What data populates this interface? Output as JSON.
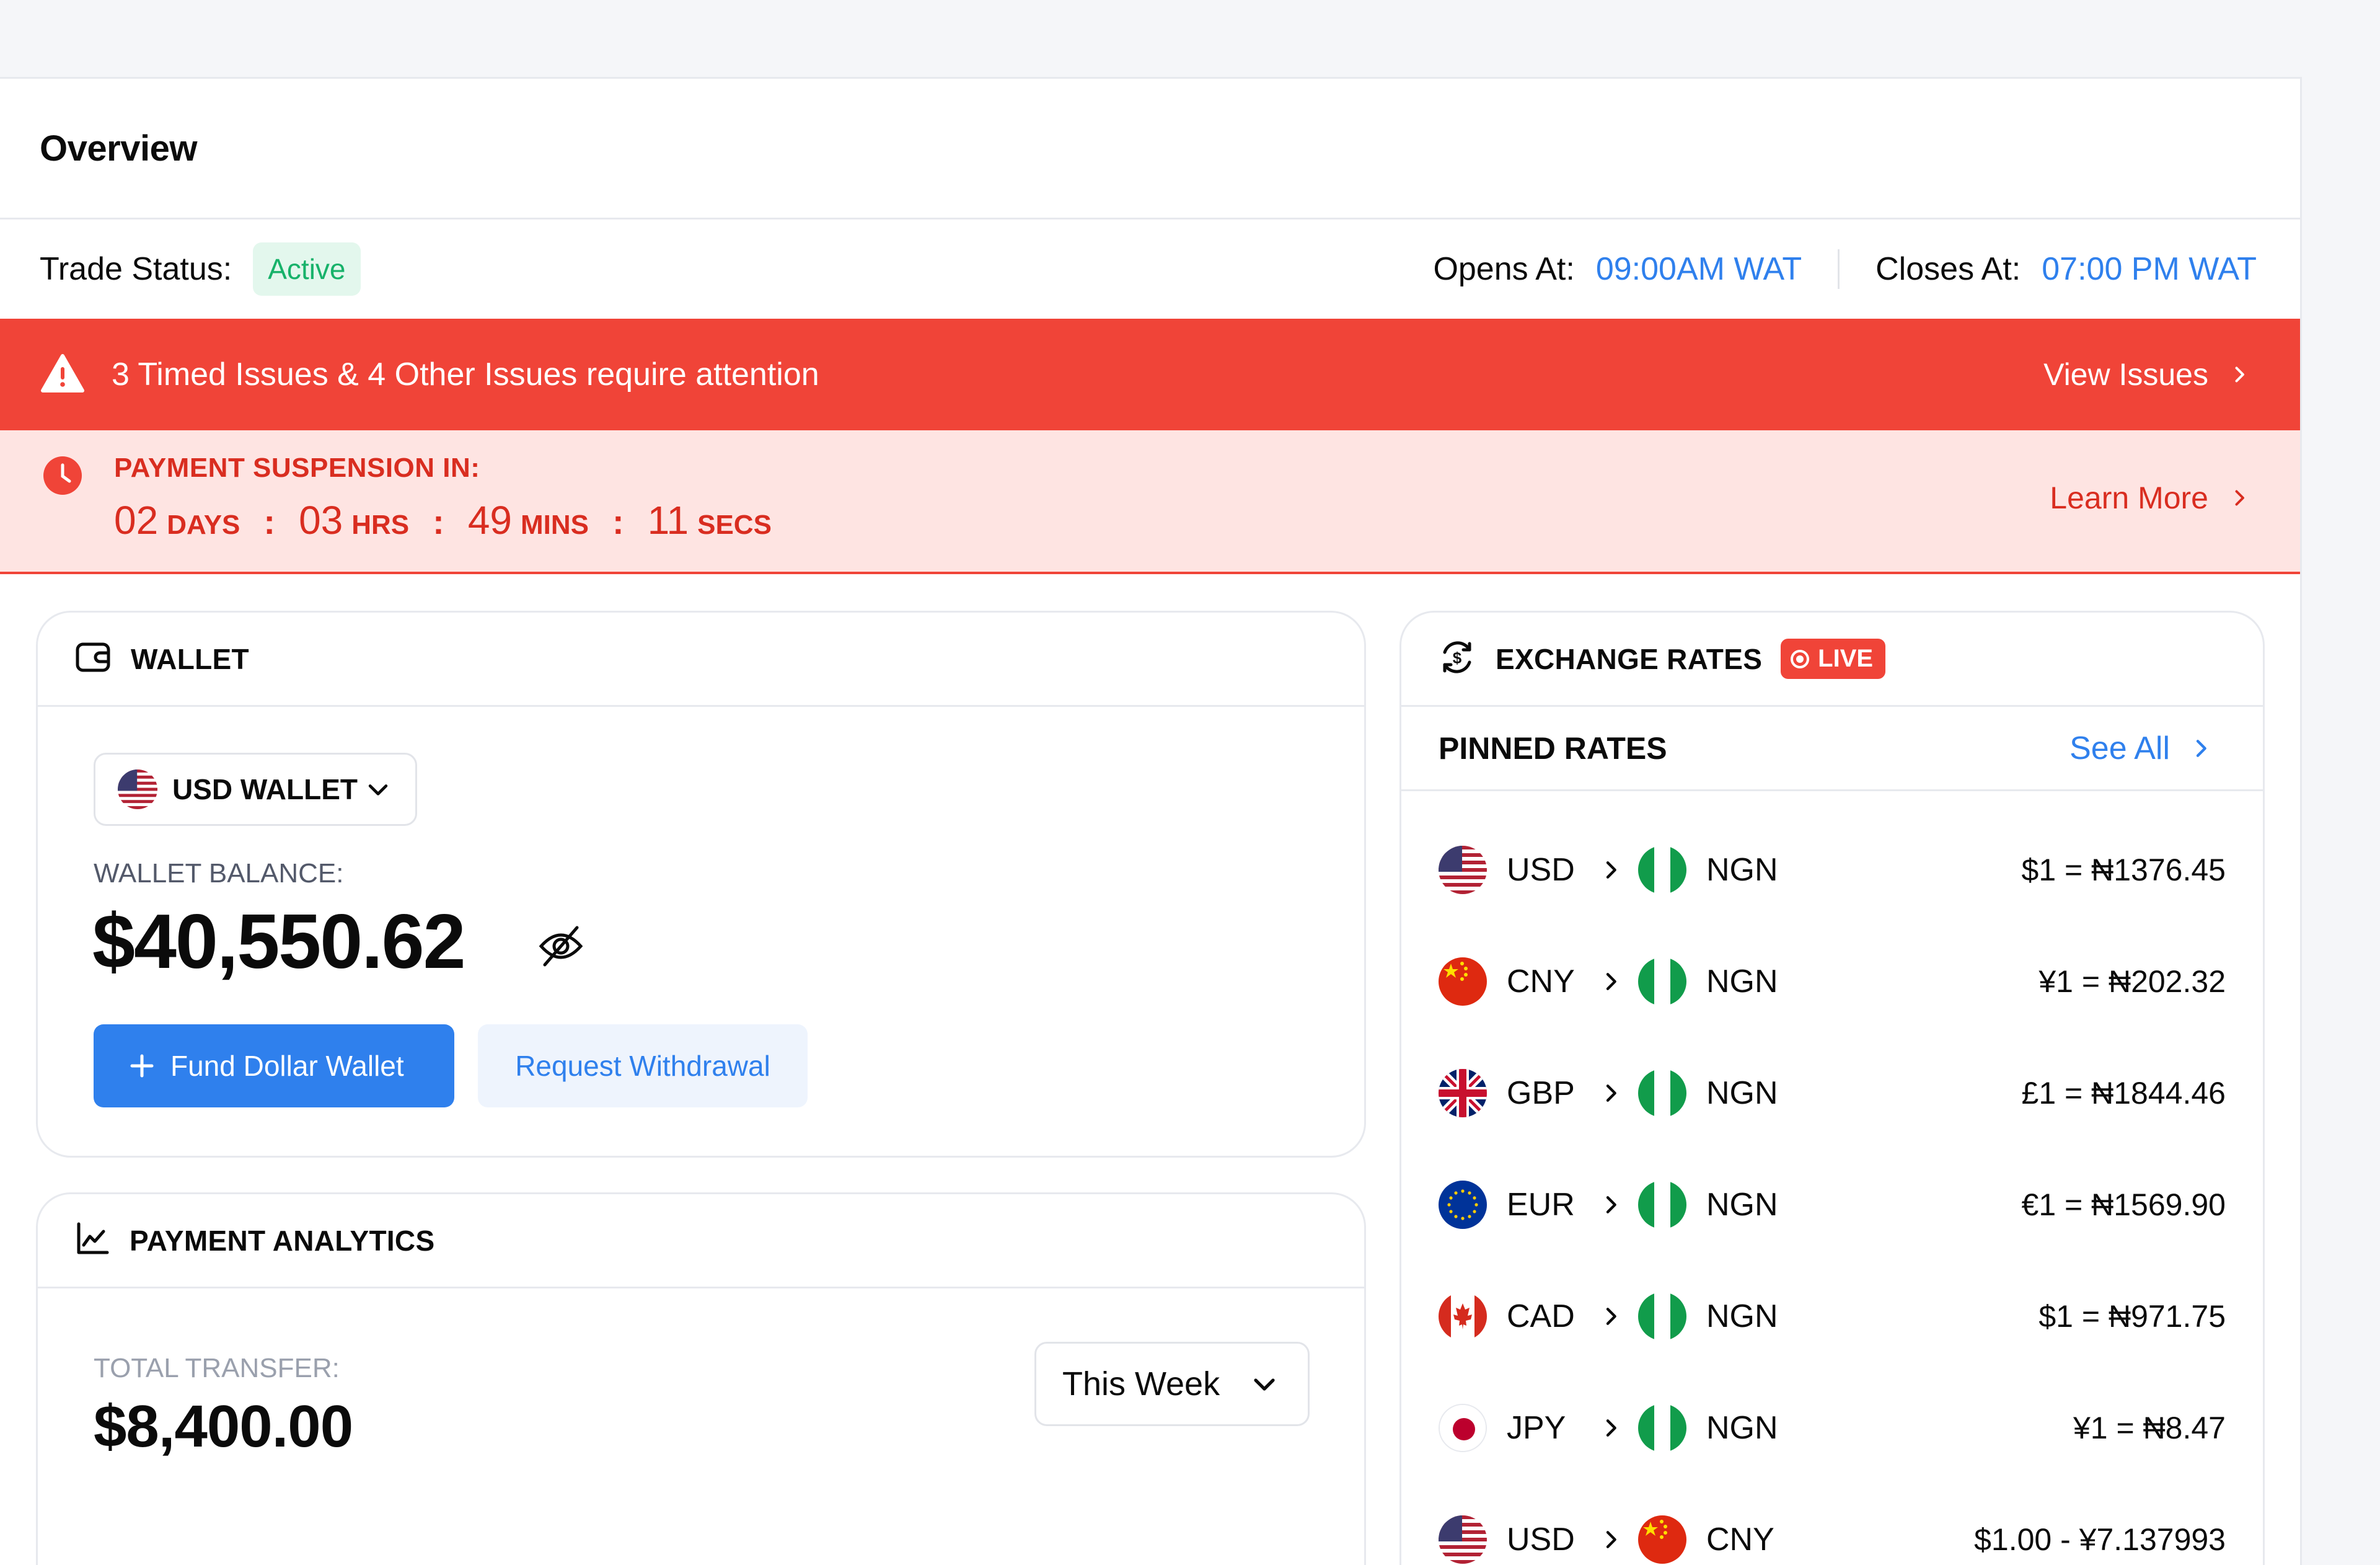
{
  "page": {
    "title": "Overview"
  },
  "trade": {
    "status_label": "Trade Status:",
    "status_value": "Active",
    "opens_label": "Opens At:",
    "opens_value": "09:00AM WAT",
    "closes_label": "Closes At:",
    "closes_value": "07:00 PM WAT"
  },
  "alert": {
    "message": "3 Timed Issues & 4 Other Issues require attention",
    "action": "View Issues"
  },
  "suspension": {
    "label": "PAYMENT SUSPENSION IN:",
    "days": "02",
    "days_unit": "DAYS",
    "hours": "03",
    "hours_unit": "HRS",
    "mins": "49",
    "mins_unit": "MINS",
    "secs": "11",
    "secs_unit": "SECS",
    "separator": ":",
    "action": "Learn More"
  },
  "wallet": {
    "title": "WALLET",
    "selected_wallet": "USD WALLET",
    "balance_label": "WALLET BALANCE:",
    "balance": "$40,550.62",
    "fund_button": "Fund Dollar Wallet",
    "withdraw_button": "Request Withdrawal"
  },
  "analytics": {
    "title": "PAYMENT ANALYTICS",
    "total_label": "TOTAL TRANSFER:",
    "total_value": "$8,400.00",
    "period": "This Week"
  },
  "exchange": {
    "title": "EXCHANGE RATES",
    "live": "LIVE",
    "pinned_title": "PINNED RATES",
    "see_all": "See All",
    "rates": [
      {
        "from": "USD",
        "to": "NGN",
        "rate": "$1 = ₦1376.45"
      },
      {
        "from": "CNY",
        "to": "NGN",
        "rate": "¥1 = ₦202.32"
      },
      {
        "from": "GBP",
        "to": "NGN",
        "rate": "£1 = ₦1844.46"
      },
      {
        "from": "EUR",
        "to": "NGN",
        "rate": "€1 = ₦1569.90"
      },
      {
        "from": "CAD",
        "to": "NGN",
        "rate": "$1 = ₦971.75"
      },
      {
        "from": "JPY",
        "to": "NGN",
        "rate": "¥1 = ₦8.47"
      },
      {
        "from": "USD",
        "to": "CNY",
        "rate": "$1.00 - ¥7.137993"
      }
    ]
  },
  "colors": {
    "accent": "#2f80ed",
    "danger": "#f04438",
    "danger_soft": "#fee4e2",
    "success": "#17b26a",
    "success_soft": "#e3f7ed"
  }
}
